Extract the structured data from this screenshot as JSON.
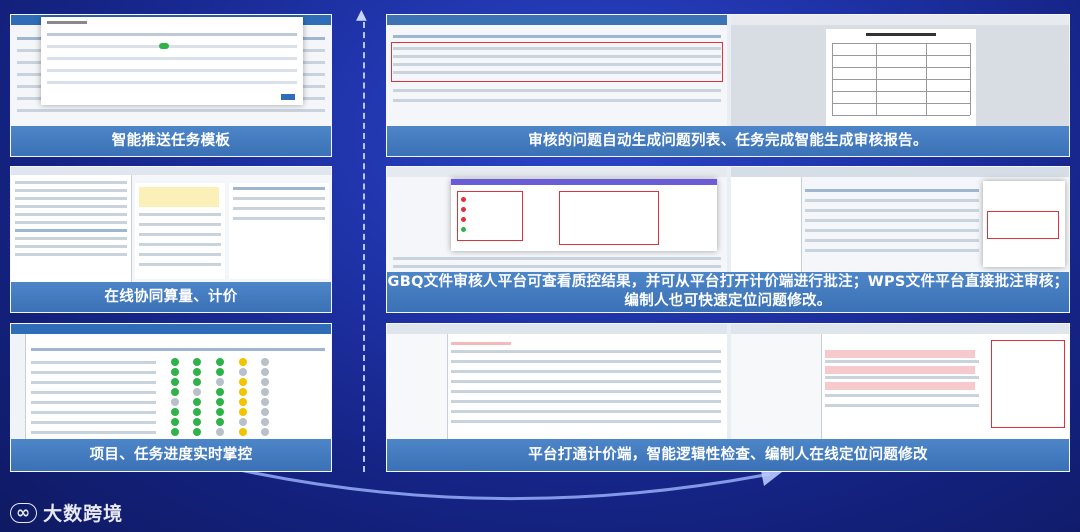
{
  "captions": {
    "panel1": "智能推送任务模板",
    "panel2": "审核的问题自动生成问题列表、任务完成智能生成审核报告。",
    "panel3": "在线协同算量、计价",
    "panel4": "GBQ文件审核人平台可查看质控结果，并可从平台打开计价端进行批注；WPS文件平台直接批注审核；编制人也可快速定位问题修改。",
    "panel5": "项目、任务进度实时掌控",
    "panel6": "平台打通计价端，智能逻辑性检查、编制人在线定位问题修改"
  },
  "logo": {
    "text": "大数跨境",
    "icon": "link-logo-icon"
  },
  "colors": {
    "background": "#1f33a8",
    "caption_bg": "#3b71b6",
    "highlight": "#e0323a",
    "status_green": "#2fb24a",
    "status_yellow": "#f2c300"
  }
}
